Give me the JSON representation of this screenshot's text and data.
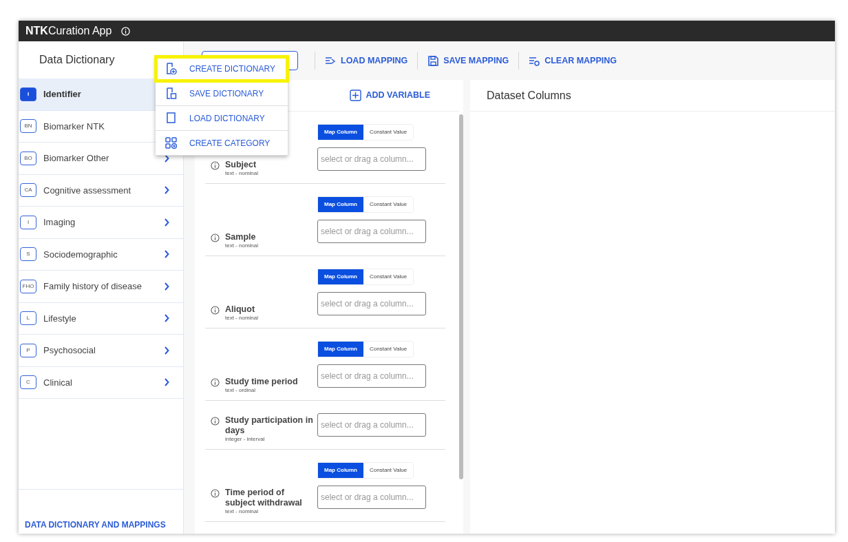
{
  "app": {
    "brand_bold": "NTK",
    "brand_rest": "Curation App"
  },
  "sidebar": {
    "title": "Data Dictionary",
    "items": [
      {
        "abbr": "I",
        "label": "Identifier",
        "selected": true
      },
      {
        "abbr": "BN",
        "label": "Biomarker NTK",
        "selected": false
      },
      {
        "abbr": "BO",
        "label": "Biomarker Other",
        "selected": false
      },
      {
        "abbr": "CA",
        "label": "Cognitive assessment",
        "selected": false
      },
      {
        "abbr": "I",
        "label": "Imaging",
        "selected": false
      },
      {
        "abbr": "S",
        "label": "Sociodemographic",
        "selected": false
      },
      {
        "abbr": "FHO",
        "label": "Family history of disease",
        "selected": false
      },
      {
        "abbr": "L",
        "label": "Lifestyle",
        "selected": false
      },
      {
        "abbr": "P",
        "label": "Psychosocial",
        "selected": false
      },
      {
        "abbr": "C",
        "label": "Clinical",
        "selected": false
      }
    ],
    "footer_link": "DATA DICTIONARY AND MAPPINGS"
  },
  "dictionary_menu": [
    {
      "label": "CREATE DICTIONARY",
      "highlighted": true
    },
    {
      "label": "SAVE DICTIONARY",
      "highlighted": false
    },
    {
      "label": "LOAD DICTIONARY",
      "highlighted": false
    },
    {
      "label": "CREATE CATEGORY",
      "highlighted": false
    }
  ],
  "toolbar": [
    {
      "label": "LOAD MAPPING"
    },
    {
      "label": "SAVE MAPPING"
    },
    {
      "label": "CLEAR MAPPING"
    }
  ],
  "variables": {
    "add_button": "ADD VARIABLE",
    "rows": [
      {
        "name": "Subject",
        "type": "text - nominal",
        "toggle": [
          {
            "label": "Map Column",
            "selected": true
          },
          {
            "label": "Constant Value",
            "selected": false
          }
        ],
        "placeholder": "select or drag a column..."
      },
      {
        "name": "Sample",
        "type": "text - nominal",
        "toggle": [
          {
            "label": "Map Column",
            "selected": true
          },
          {
            "label": "Constant Value",
            "selected": false
          }
        ],
        "placeholder": "select or drag a column..."
      },
      {
        "name": "Aliquot",
        "type": "text - nominal",
        "toggle": [
          {
            "label": "Map Column",
            "selected": true
          },
          {
            "label": "Constant Value",
            "selected": false
          }
        ],
        "placeholder": "select or drag a column..."
      },
      {
        "name": "Study time period",
        "type": "text - ordinal",
        "toggle": [
          {
            "label": "Map Column",
            "selected": true
          },
          {
            "label": "Constant Value",
            "selected": false
          }
        ],
        "placeholder": "select or drag a column..."
      },
      {
        "name": "Study participation in days",
        "type": "integer - interval",
        "placeholder": "select or drag a column..."
      },
      {
        "name": "Time period of subject withdrawal",
        "type": "text - nominal",
        "toggle": [
          {
            "label": "Map Column",
            "selected": true
          },
          {
            "label": "Constant Value",
            "selected": false
          }
        ],
        "placeholder": "select or drag a column..."
      }
    ]
  },
  "dataset_columns": {
    "title": "Dataset Columns"
  }
}
